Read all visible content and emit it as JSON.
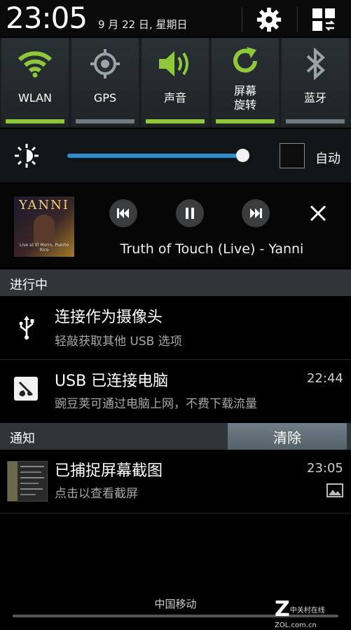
{
  "status": {
    "time": "23:05",
    "date": "9 月 22 日, 星期日"
  },
  "quick_settings": [
    {
      "id": "wlan",
      "label": "WLAN",
      "icon": "wifi-icon",
      "state": "on"
    },
    {
      "id": "gps",
      "label": "GPS",
      "icon": "gps-icon",
      "state": "off"
    },
    {
      "id": "sound",
      "label": "声音",
      "icon": "volume-icon",
      "state": "on"
    },
    {
      "id": "rotate",
      "label": "屏幕\n旋转",
      "icon": "rotate-icon",
      "state": "on"
    },
    {
      "id": "bluetooth",
      "label": "蓝牙",
      "icon": "bluetooth-icon",
      "state": "off"
    }
  ],
  "brightness": {
    "auto_label": "自动",
    "auto_checked": false,
    "level": 0.97
  },
  "music": {
    "album_text": "YANNI",
    "album_subtext": "Live at El Morro, Puerto Rico",
    "track": "Truth of Touch (Live) - Yanni"
  },
  "ongoing": {
    "label": "进行中",
    "items": [
      {
        "title": "连接作为摄像头",
        "subtitle": "轻敲获取其他 USB 选项",
        "time": "",
        "icon": "usb-icon"
      },
      {
        "title": "USB 已连接电脑",
        "subtitle": "豌豆荚可通过电脑上网，不费下载流量",
        "time": "22:44",
        "icon": "wandoujia-icon"
      }
    ]
  },
  "notifications": {
    "label": "通知",
    "clear_label": "清除",
    "items": [
      {
        "title": "已捕捉屏幕截图",
        "subtitle": "点击以查看截屏",
        "time": "23:05",
        "icon": "screenshot-thumbnail"
      }
    ]
  },
  "footer": {
    "carrier": "中国移动",
    "watermark": "中关村在线 ZOL.com.cn"
  },
  "colors": {
    "accent_on": "#8fc83a",
    "accent_off": "#707a80",
    "slider": "#2b8fcf"
  }
}
